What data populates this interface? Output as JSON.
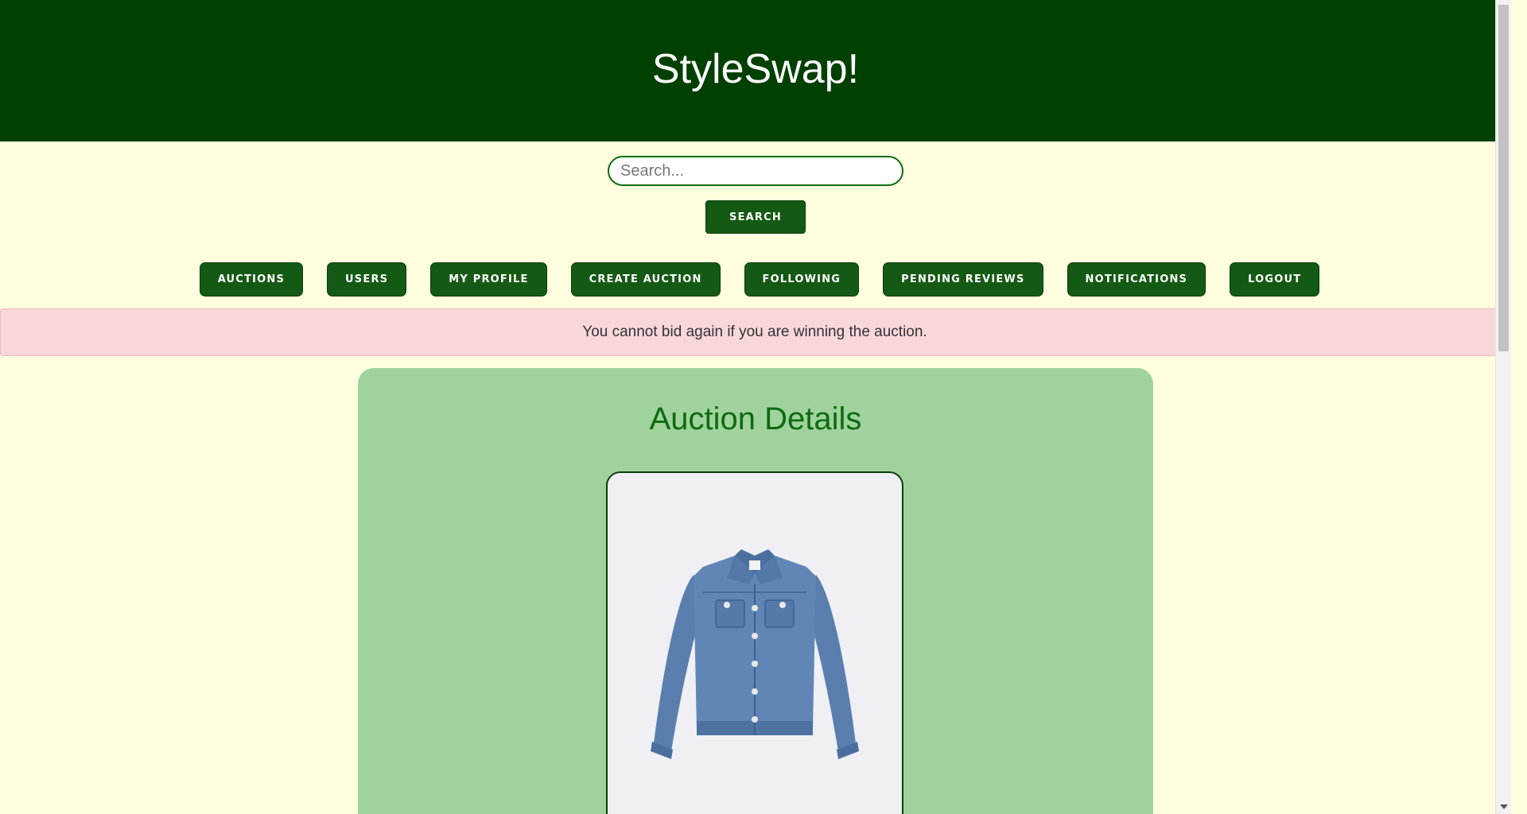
{
  "header": {
    "title": "StyleSwap!"
  },
  "search": {
    "placeholder": "Search...",
    "value": "",
    "button_label": "SEARCH"
  },
  "nav": {
    "items": [
      {
        "label": "AUCTIONS"
      },
      {
        "label": "USERS"
      },
      {
        "label": "MY PROFILE"
      },
      {
        "label": "CREATE AUCTION"
      },
      {
        "label": "FOLLOWING"
      },
      {
        "label": "PENDING REVIEWS"
      },
      {
        "label": "NOTIFICATIONS"
      },
      {
        "label": "LOGOUT"
      }
    ]
  },
  "alert": {
    "message": "You cannot bid again if you are winning the auction."
  },
  "auction": {
    "heading": "Auction Details",
    "image_icon": "denim-jacket-icon"
  },
  "colors": {
    "header_bg": "#004000",
    "page_bg": "#ffffe0",
    "button_bg": "#145a14",
    "card_bg": "#a0d29e",
    "heading_text": "#0d6b0d",
    "alert_bg": "#f8d7da"
  }
}
